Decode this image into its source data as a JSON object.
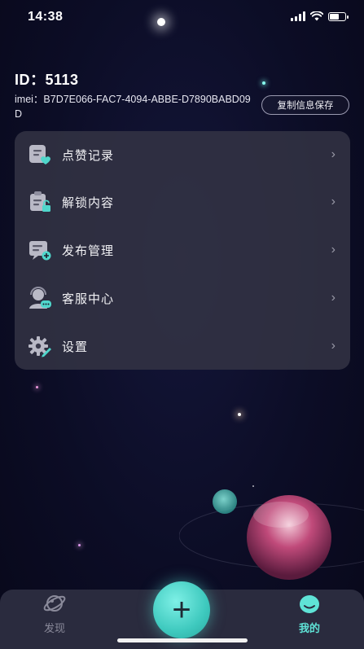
{
  "status_bar": {
    "time": "14:38"
  },
  "profile": {
    "id_text": "ID：5113",
    "imei_text": "imei：B7D7E066-FAC7-4094-ABBE-D7890BABD09D",
    "copy_button": "复制信息保存"
  },
  "menu": {
    "items": [
      {
        "label": "点赞记录",
        "icon": "like-record-icon"
      },
      {
        "label": "解锁内容",
        "icon": "unlock-content-icon"
      },
      {
        "label": "发布管理",
        "icon": "publish-manage-icon"
      },
      {
        "label": "客服中心",
        "icon": "customer-service-icon"
      },
      {
        "label": "设置",
        "icon": "settings-icon"
      }
    ],
    "chevron": "›"
  },
  "tabbar": {
    "discover_label": "发现",
    "mine_label": "我的",
    "fab_label": "+",
    "active_color": "#5fe3d6",
    "inactive_color": "#8a8a9a"
  }
}
